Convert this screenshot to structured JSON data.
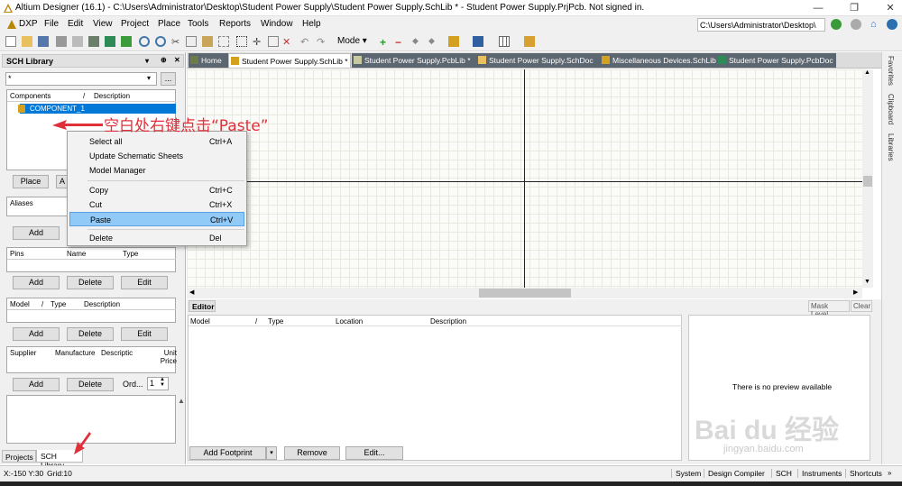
{
  "window": {
    "title": "Altium Designer (16.1) - C:\\Users\\Administrator\\Desktop\\Student Power Supply\\Student Power Supply.SchLib * - Student Power Supply.PrjPcb. Not signed in.",
    "path": "C:\\Users\\Administrator\\Desktop\\",
    "minimize": "—",
    "restore": "❐",
    "close": "✕"
  },
  "menu": [
    "DXP",
    "File",
    "Edit",
    "View",
    "Project",
    "Place",
    "Tools",
    "Reports",
    "Window",
    "Help"
  ],
  "toolbar": {
    "mode_label": "Mode ▾"
  },
  "panel": {
    "title": "SCH Library",
    "filter_value": "*",
    "filter_btn": "...",
    "components_headers": [
      "Components",
      "/",
      "Description"
    ],
    "components": [
      {
        "name": "COMPONENT_1"
      }
    ],
    "place_btn": "Place",
    "add2_btn": "A",
    "aliases_header": "Aliases",
    "aliases_add": "Add",
    "pins_headers": [
      "Pins",
      "Name",
      "Type"
    ],
    "pins_add": "Add",
    "pins_delete": "Delete",
    "pins_edit": "Edit",
    "model_headers": [
      "Model",
      "/",
      "Type",
      "Description"
    ],
    "model_add": "Add",
    "model_delete": "Delete",
    "model_edit": "Edit",
    "supplier_headers": [
      "Supplier",
      "Manufacture",
      "Descriptic",
      "Unit Price"
    ],
    "supplier_add": "Add",
    "supplier_delete": "Delete",
    "order_label": "Ord...",
    "order_value": "1",
    "bottom_tabs": [
      "Projects",
      "SCH Library"
    ]
  },
  "tabs": [
    {
      "label": "Home",
      "active": false
    },
    {
      "label": "Student Power Supply.SchLib *",
      "active": true
    },
    {
      "label": "Student Power Supply.PcbLib *",
      "active": false
    },
    {
      "label": "Student Power Supply.SchDoc",
      "active": false
    },
    {
      "label": "Miscellaneous Devices.SchLib",
      "active": false
    },
    {
      "label": "Student Power Supply.PcbDoc",
      "active": false
    }
  ],
  "right_tabs": [
    "Favorites",
    "Clipboard",
    "Libraries"
  ],
  "editor": {
    "tab": "Editor",
    "mask_level": "Mask Level",
    "clear": "Clear",
    "headers": [
      "Model",
      "/",
      "Type",
      "Location",
      "Description"
    ],
    "preview_text": "There is no preview available",
    "add_footprint": "Add Footprint",
    "remove": "Remove",
    "edit": "Edit..."
  },
  "context_menu": {
    "items": [
      {
        "label": "Select all",
        "shortcut": "Ctrl+A"
      },
      {
        "label": "Update Schematic Sheets",
        "shortcut": ""
      },
      {
        "label": "Model Manager",
        "shortcut": ""
      },
      {
        "label": "Copy",
        "shortcut": "Ctrl+C"
      },
      {
        "label": "Cut",
        "shortcut": "Ctrl+X"
      },
      {
        "label": "Paste",
        "shortcut": "Ctrl+V"
      },
      {
        "label": "Delete",
        "shortcut": "Del"
      }
    ]
  },
  "annotation": "空白处右键点击“Paste”",
  "status": {
    "coords": "X:-150 Y:30",
    "grid": "Grid:10",
    "items": [
      "System",
      "Design Compiler",
      "SCH",
      "Instruments",
      "Shortcuts"
    ]
  },
  "watermark": {
    "main": "Bai du 经验",
    "sub": "jingyan.baidu.com"
  },
  "colors": {
    "selection": "#0078d7",
    "menu_highlight": "#91c9f7",
    "annotation": "#e0303a"
  }
}
